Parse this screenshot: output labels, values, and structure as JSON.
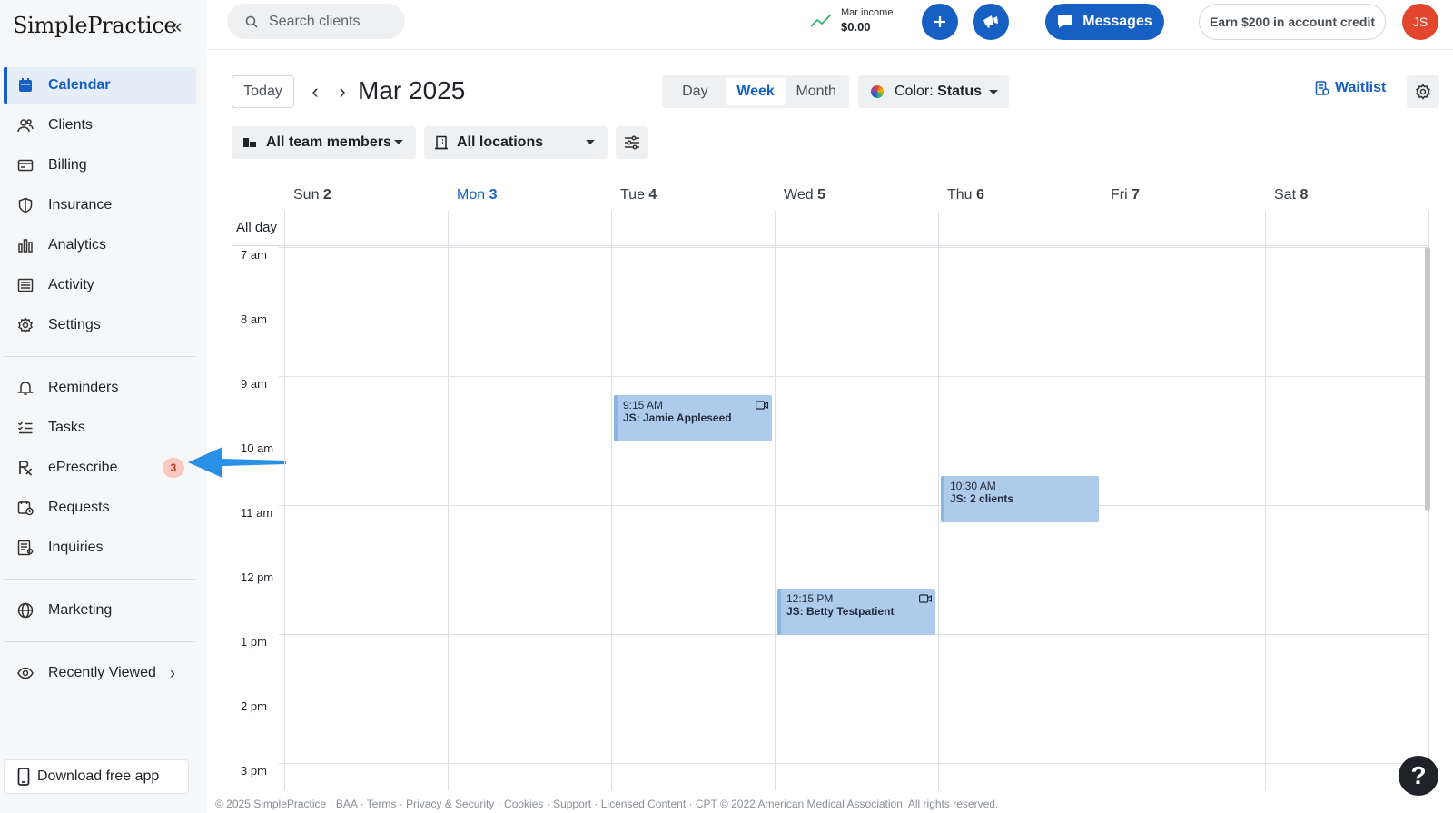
{
  "app": {
    "logo_text": "SimplePractice",
    "brand_color": "#1660c4"
  },
  "sidebar": {
    "items": [
      {
        "label": "Calendar",
        "icon": "calendar-icon",
        "active": true
      },
      {
        "label": "Clients",
        "icon": "clients-icon"
      },
      {
        "label": "Billing",
        "icon": "billing-icon"
      },
      {
        "label": "Insurance",
        "icon": "shield-icon"
      },
      {
        "label": "Analytics",
        "icon": "bar-chart-icon"
      },
      {
        "label": "Activity",
        "icon": "list-icon"
      },
      {
        "label": "Settings",
        "icon": "gear-icon"
      }
    ],
    "items2": [
      {
        "label": "Reminders",
        "icon": "bell-icon"
      },
      {
        "label": "Tasks",
        "icon": "checklist-icon"
      },
      {
        "label": "ePrescribe",
        "icon": "rx-icon",
        "badge": "3"
      },
      {
        "label": "Requests",
        "icon": "calendar-request-icon"
      },
      {
        "label": "Inquiries",
        "icon": "inquiries-icon"
      }
    ],
    "marketing": {
      "label": "Marketing",
      "icon": "globe-icon"
    },
    "recently_viewed": {
      "label": "Recently Viewed",
      "icon": "eye-icon"
    },
    "download": "Download free app"
  },
  "topbar": {
    "search_placeholder": "Search clients",
    "income_label": "Mar income",
    "income_value": "$0.00",
    "messages": "Messages",
    "earn": "Earn $200 in account credit",
    "avatar": "JS"
  },
  "toolbar": {
    "today": "Today",
    "month_title": "Mar 2025",
    "views": [
      "Day",
      "Week",
      "Month"
    ],
    "active_view": "Week",
    "color_label": "Color:",
    "color_value": "Status",
    "waitlist": "Waitlist",
    "team_filter": "All team members",
    "location_filter": "All locations"
  },
  "calendar": {
    "days": [
      {
        "name": "Sun",
        "num": "2"
      },
      {
        "name": "Mon",
        "num": "3",
        "today": true
      },
      {
        "name": "Tue",
        "num": "4"
      },
      {
        "name": "Wed",
        "num": "5"
      },
      {
        "name": "Thu",
        "num": "6"
      },
      {
        "name": "Fri",
        "num": "7"
      },
      {
        "name": "Sat",
        "num": "8"
      }
    ],
    "all_day_label": "All day",
    "hours": [
      "7 am",
      "8 am",
      "9 am",
      "10 am",
      "11 am",
      "12 pm",
      "1 pm",
      "2 pm",
      "3 pm"
    ],
    "events": [
      {
        "time": "9:15 AM",
        "title": "JS: Jamie Appleseed",
        "video": true
      },
      {
        "time": "10:30 AM",
        "title": "JS: 2 clients",
        "video": false
      },
      {
        "time": "12:15 PM",
        "title": "JS: Betty Testpatient",
        "video": true
      }
    ],
    "event_color": "#aecbec"
  },
  "footer": "© 2025 SimplePractice · BAA · Terms · Privacy & Security · Cookies · Support · Licensed Content · CPT © 2022 American Medical Association. All rights reserved.",
  "help": "?"
}
